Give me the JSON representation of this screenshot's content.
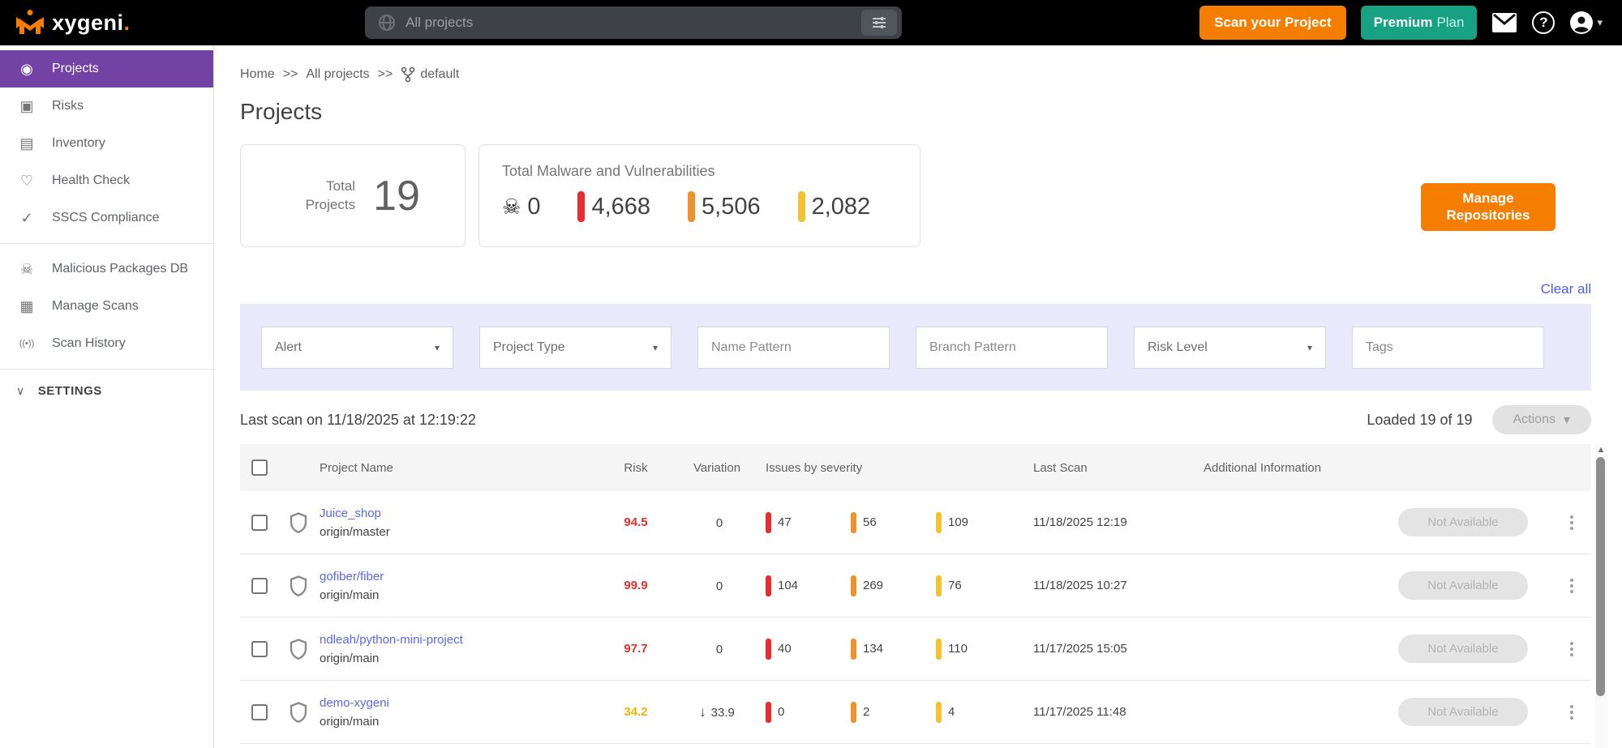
{
  "header": {
    "brand_text": "xygeni",
    "brand_dot": ".",
    "scope_label": "All projects",
    "scan_button": "Scan your Project",
    "plan_bold": "Premium",
    "plan_light": "Plan",
    "avatar_caret": "▾"
  },
  "sidebar": {
    "items": [
      {
        "icon": "◉",
        "label": "Projects",
        "active": true
      },
      {
        "icon": "▣",
        "label": "Risks"
      },
      {
        "icon": "▤",
        "label": "Inventory"
      },
      {
        "icon": "♡",
        "label": "Health Check"
      },
      {
        "icon": "✓",
        "label": "SSCS Compliance"
      },
      {
        "icon": "☠",
        "label": "Malicious Packages DB"
      },
      {
        "icon": "▦",
        "label": "Manage Scans"
      },
      {
        "icon": "((•))",
        "label": "Scan History"
      }
    ],
    "settings": {
      "chevron": "∨",
      "label": "SETTINGS"
    }
  },
  "breadcrumb": {
    "home": "Home",
    "sep1": ">>",
    "all": "All projects",
    "sep2": ">>",
    "current": "default"
  },
  "page": {
    "title": "Projects"
  },
  "cards": {
    "total": {
      "label": "Total Projects",
      "value": "19"
    },
    "malware": {
      "title": "Total Malware and Vulnerabilities",
      "skull": "☠",
      "skull_value": "0",
      "critical": "4,668",
      "high": "5,506",
      "medium": "2,082"
    }
  },
  "actions": {
    "manage_repositories": "Manage Repositories",
    "clear_all": "Clear all"
  },
  "filters": [
    {
      "label": "Alert",
      "kind": "select"
    },
    {
      "label": "Project Type",
      "kind": "select"
    },
    {
      "label": "Name Pattern",
      "kind": "input"
    },
    {
      "label": "Branch Pattern",
      "kind": "input"
    },
    {
      "label": "Risk Level",
      "kind": "select"
    },
    {
      "label": "Tags",
      "kind": "input"
    }
  ],
  "ui": {
    "caret": "▾"
  },
  "scanbar": {
    "last_scan": "Last scan on 11/18/2025 at 12:19:22",
    "loaded": "Loaded 19 of 19",
    "actions_label": "Actions"
  },
  "table": {
    "columns": {
      "name": "Project Name",
      "risk": "Risk",
      "variation": "Variation",
      "issues": "Issues by severity",
      "last_scan": "Last Scan",
      "additional": "Additional Information"
    },
    "rows": [
      {
        "name": "Juice_shop",
        "branch": "origin/master",
        "risk": "94.5",
        "risk_color": "#e53030",
        "variation_arrow": "",
        "variation": "0",
        "sev_critical": "47",
        "sev_high": "56",
        "sev_medium": "109",
        "last_scan": "11/18/2025 12:19",
        "action": "Not Available"
      },
      {
        "name": "gofiber/fiber",
        "branch": "origin/main",
        "risk": "99.9",
        "risk_color": "#e53030",
        "variation_arrow": "",
        "variation": "0",
        "sev_critical": "104",
        "sev_high": "269",
        "sev_medium": "76",
        "last_scan": "11/18/2025 10:27",
        "action": "Not Available"
      },
      {
        "name": "ndleah/python-mini-project",
        "branch": "origin/main",
        "risk": "97.7",
        "risk_color": "#e53030",
        "variation_arrow": "",
        "variation": "0",
        "sev_critical": "40",
        "sev_high": "134",
        "sev_medium": "110",
        "last_scan": "11/17/2025 15:05",
        "action": "Not Available"
      },
      {
        "name": "demo-xygeni",
        "branch": "origin/main",
        "risk": "34.2",
        "risk_color": "#f0b400",
        "variation_arrow": "↓",
        "variation": "33.9",
        "sev_critical": "0",
        "sev_high": "2",
        "sev_medium": "4",
        "last_scan": "11/17/2025 11:48",
        "action": "Not Available"
      }
    ]
  },
  "colors": {
    "accent_orange": "#f57d00",
    "teal": "#16a283",
    "sidebar_purple": "#7243a5",
    "link_blue": "#5868e8",
    "risk_red": "#e53030",
    "risk_amber": "#f0b400",
    "sev_red": "#e62e2e",
    "sev_orange": "#f0922b",
    "sev_yellow": "#f2c230",
    "filterbar_bg": "#e9e9fb"
  }
}
